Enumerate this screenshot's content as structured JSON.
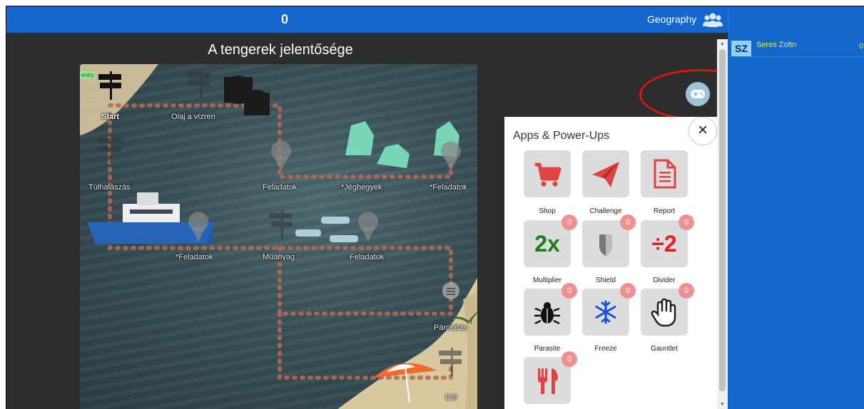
{
  "topbar": {
    "score": "0",
    "subject": "Geography",
    "group_icon": "users-icon"
  },
  "game": {
    "title": "A tengerek jelentősége",
    "entry_tag": "entry",
    "labels": {
      "start": "Start",
      "olaj": "Olaj a vízren",
      "tulhalaszas": "Túlhalászás",
      "feladatok_1": "Feladatok",
      "jeghegyek": "*Jéghegyek",
      "feladatok_2": "*Feladatok",
      "feladatok_3": "*Feladatok",
      "muanyag": "Műanyag",
      "feladatok_4": "Feladatok",
      "parositas": "Párosítás",
      "cel": "Cél"
    }
  },
  "gamepad_button_icon": "gamepad-icon",
  "panel": {
    "title": "Apps & Power-Ups",
    "close_label": "×",
    "items": [
      {
        "label": "Shop",
        "icon": "cart-icon",
        "color": "#e04343"
      },
      {
        "label": "Challenge",
        "icon": "paper-plane-icon",
        "color": "#e04343"
      },
      {
        "label": "Report",
        "icon": "document-icon",
        "color": "#e04343"
      },
      {
        "label": "Multiplier",
        "icon": "2x",
        "badge": "0",
        "color": "#1a7d1a"
      },
      {
        "label": "Shield",
        "icon": "shield-icon",
        "badge": "0",
        "color": "#777777"
      },
      {
        "label": "Divider",
        "icon": "÷2",
        "badge": "0",
        "color": "#e02020"
      },
      {
        "label": "Parasite",
        "icon": "bug-icon",
        "badge": "0",
        "color": "#111111"
      },
      {
        "label": "Freeze",
        "icon": "snowflake-icon",
        "badge": "0",
        "color": "#1a4fe0"
      },
      {
        "label": "Gauntlet",
        "icon": "hand-icon",
        "badge": "0",
        "color": "#222222"
      },
      {
        "label": "",
        "icon": "fork-knife-icon",
        "badge": "0",
        "color": "#e04343"
      }
    ]
  },
  "sidebar": {
    "player": {
      "initials": "SZ",
      "name": "Seres Zoltn",
      "score": "0"
    }
  },
  "colors": {
    "topbar": "#1466cc",
    "highlight_ring": "#e01313",
    "badge": "#ef8f8f"
  }
}
